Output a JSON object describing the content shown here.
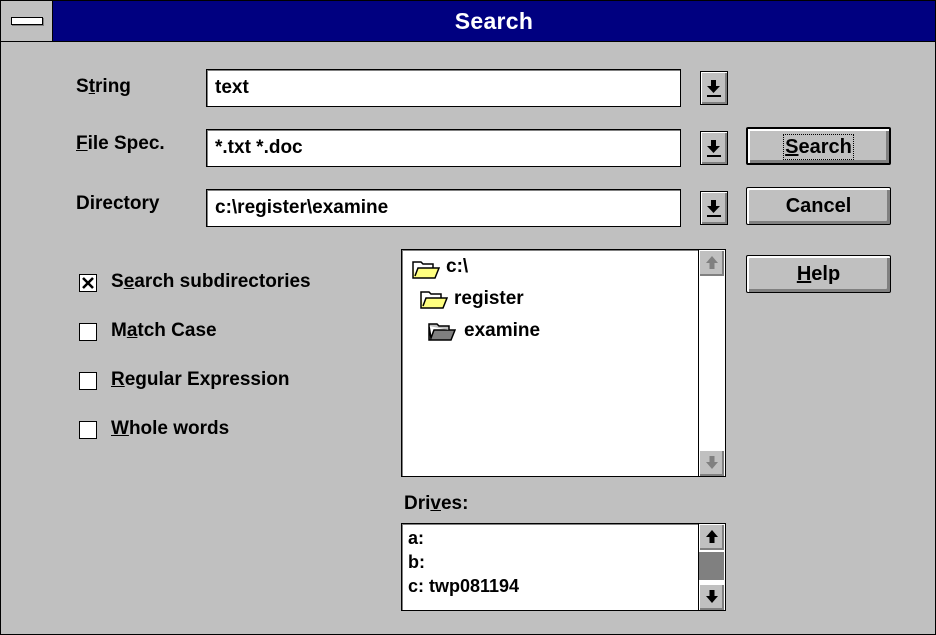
{
  "window": {
    "title": "Search"
  },
  "form": {
    "string_label": "String",
    "string_value": "text",
    "filespec_label": "File Spec.",
    "filespec_value": "*.txt *.doc",
    "directory_label": "Directory",
    "directory_value": "c:\\register\\examine"
  },
  "buttons": {
    "search": "Search",
    "cancel": "Cancel",
    "help": "Help"
  },
  "options": [
    {
      "label": "Search subdirectories",
      "checked": true
    },
    {
      "label": "Match Case",
      "checked": false
    },
    {
      "label": "Regular Expression",
      "checked": false
    },
    {
      "label": "Whole words",
      "checked": false
    }
  ],
  "directory_tree": [
    "c:\\",
    "register",
    "examine"
  ],
  "drives": {
    "label": "Drives:",
    "items": [
      "a:",
      "b:",
      "c: twp081194"
    ]
  }
}
